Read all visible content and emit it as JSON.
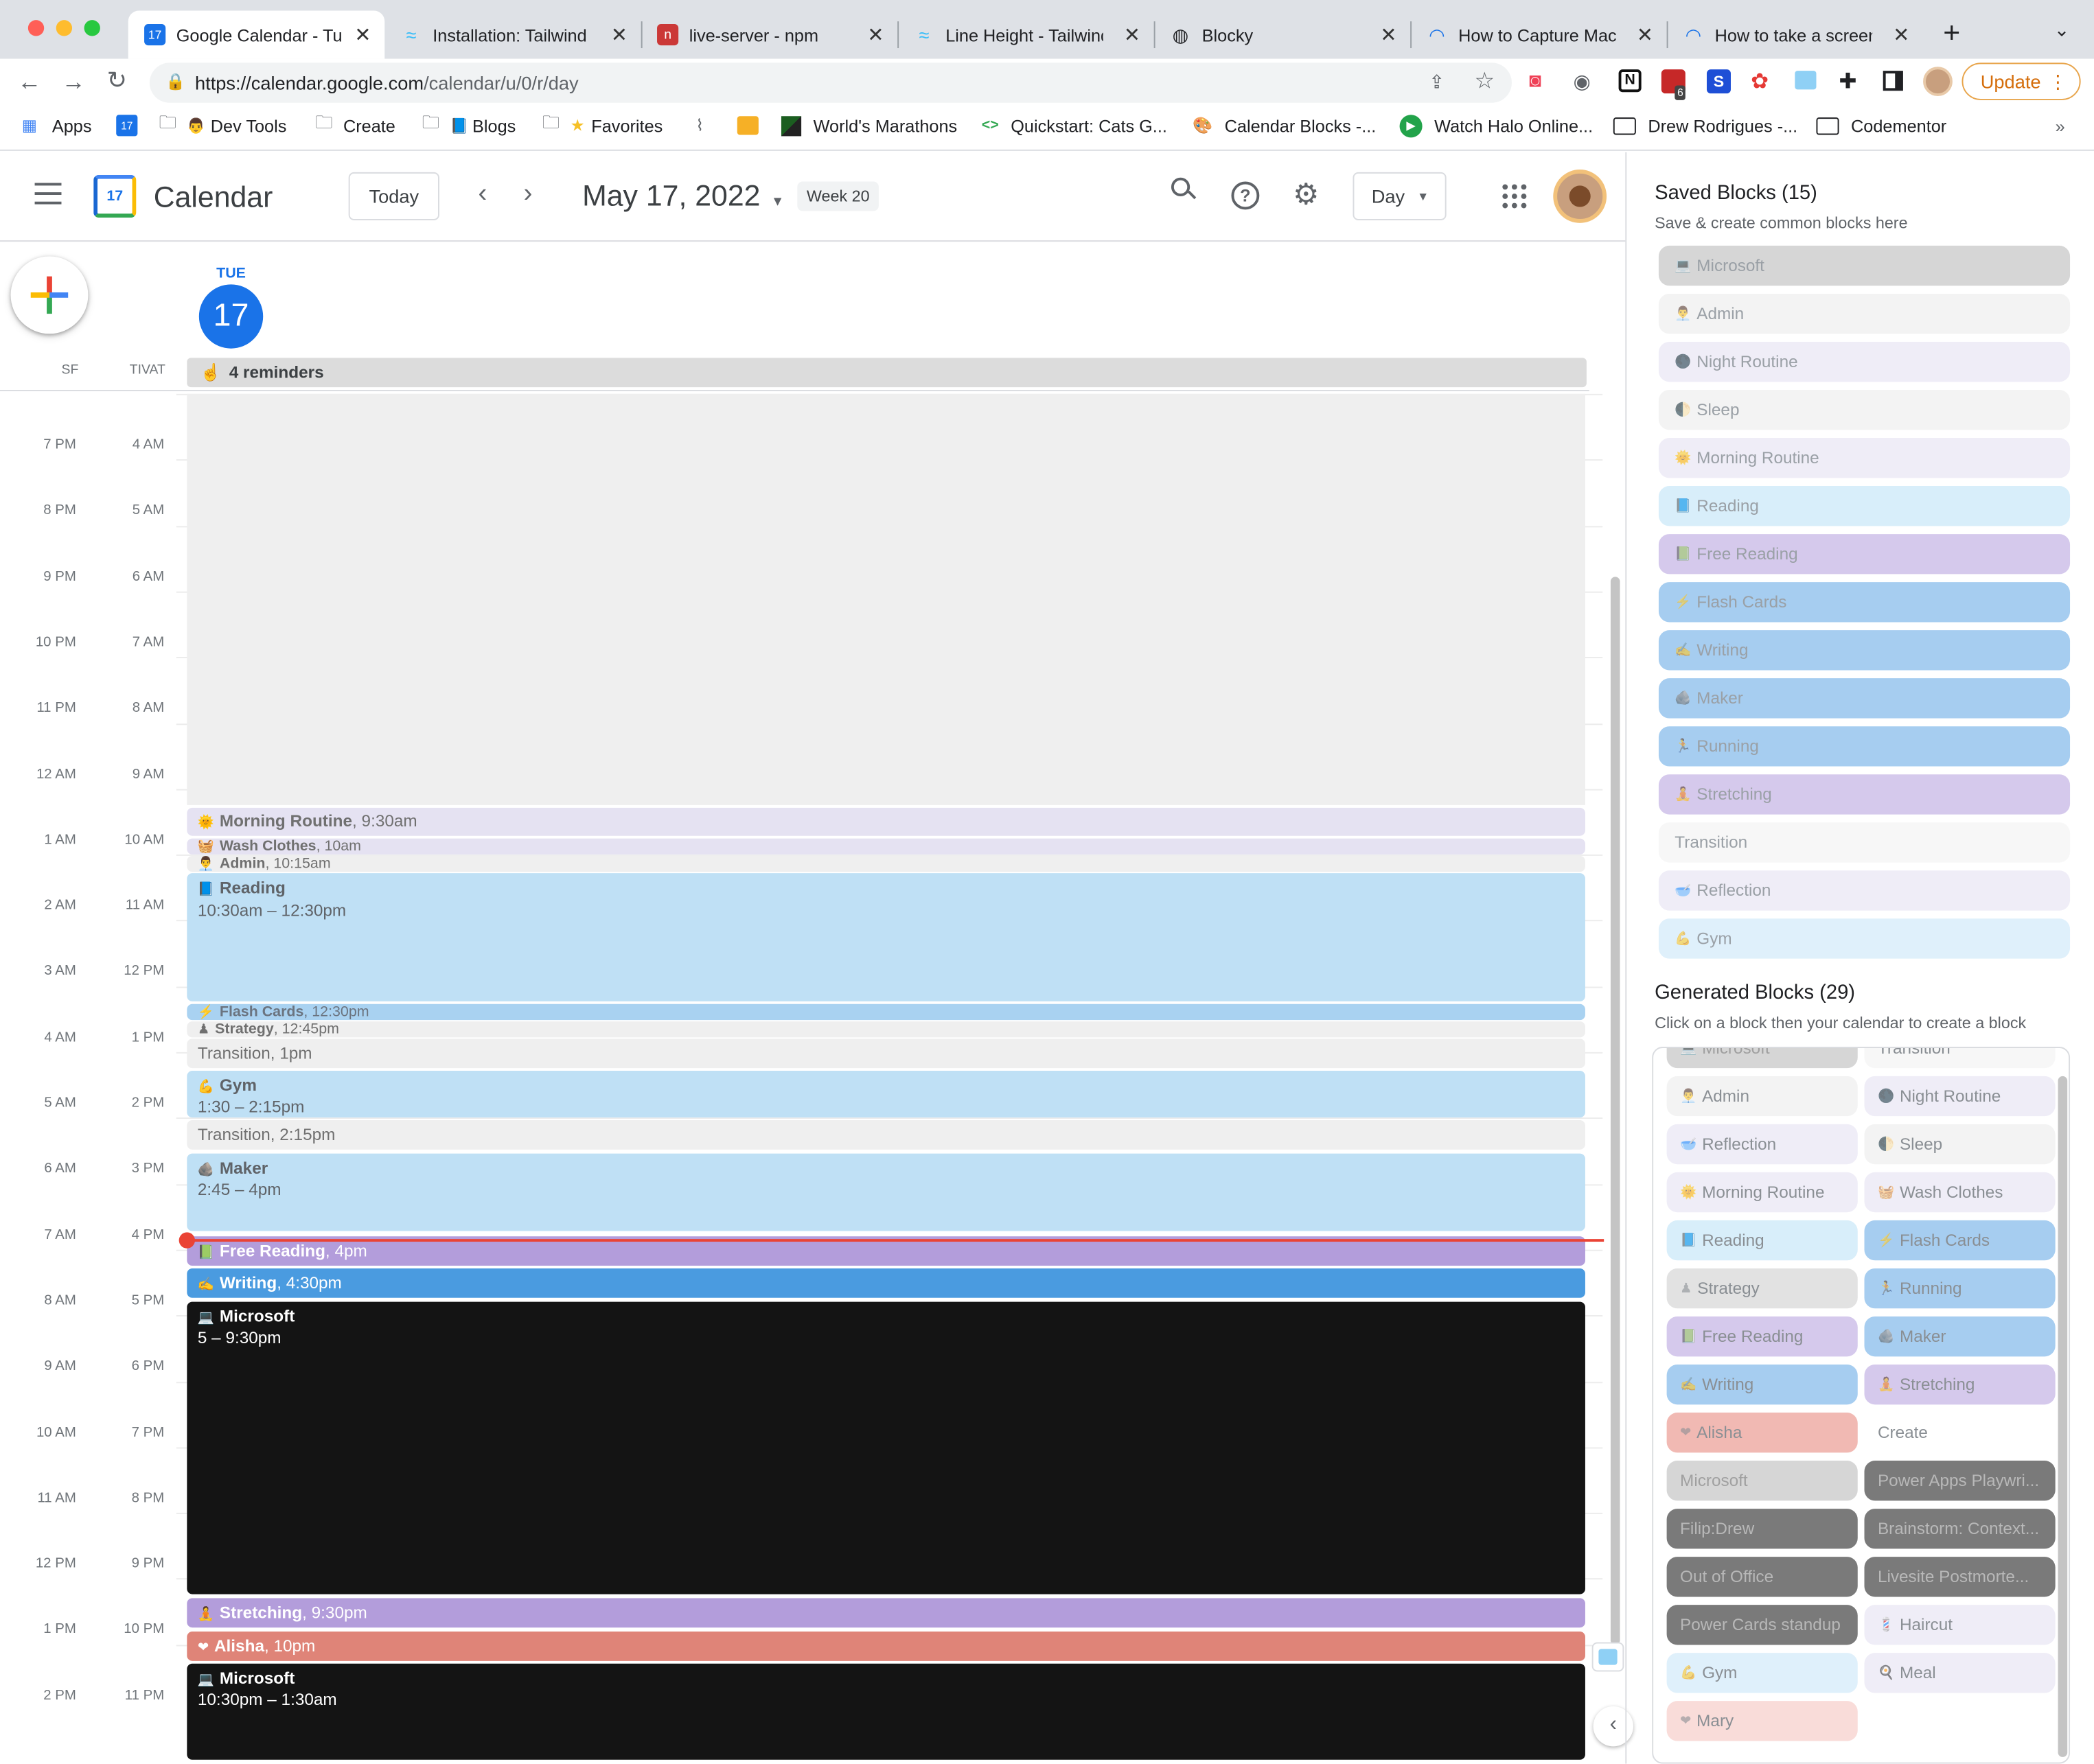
{
  "browser": {
    "tabs": [
      {
        "title": "Google Calendar - Tu",
        "icon": "calendar-icon",
        "active": true
      },
      {
        "title": "Installation: Tailwind C",
        "icon": "tailwind-icon"
      },
      {
        "title": "live-server - npm",
        "icon": "npm-icon"
      },
      {
        "title": "Line Height - Tailwind",
        "icon": "tailwind-icon"
      },
      {
        "title": "Blocky",
        "icon": "globe-icon"
      },
      {
        "title": "How to Capture Mac V",
        "icon": "loading-icon"
      },
      {
        "title": "How to take a screens",
        "icon": "loading-icon"
      }
    ],
    "url_host": "https://calendar.google.com",
    "url_path": "/calendar/u/0/r/day",
    "update_label": "Update",
    "badge_count": "6",
    "bookmarks": [
      "Apps",
      "",
      "Dev Tools",
      "Create",
      "Blogs",
      "Favorites",
      "",
      "",
      "World's Marathons",
      "Quickstart: Cats G...",
      "Calendar Blocks -...",
      "Watch Halo Online...",
      "Drew Rodrigues -...",
      "Codementor"
    ],
    "more": "»"
  },
  "header": {
    "app_name": "Calendar",
    "logo_day": "17",
    "today_label": "Today",
    "date_title": "May 17, 2022",
    "week_label": "Week 20",
    "view_label": "Day"
  },
  "day": {
    "weekday": "TUE",
    "number": "17",
    "tz1": "SF",
    "tz2": "TIVAT",
    "reminders": "4 reminders"
  },
  "times_sf": [
    "7 PM",
    "8 PM",
    "9 PM",
    "10 PM",
    "11 PM",
    "12 AM",
    "1 AM",
    "2 AM",
    "3 AM",
    "4 AM",
    "5 AM",
    "6 AM",
    "7 AM",
    "8 AM",
    "9 AM",
    "10 AM",
    "11 AM",
    "12 PM",
    "1 PM",
    "2 PM"
  ],
  "times_local": [
    "4 AM",
    "5 AM",
    "6 AM",
    "7 AM",
    "8 AM",
    "9 AM",
    "10 AM",
    "11 AM",
    "12 PM",
    "1 PM",
    "2 PM",
    "3 PM",
    "4 PM",
    "5 PM",
    "6 PM",
    "7 PM",
    "8 PM",
    "9 PM",
    "10 PM",
    "11 PM"
  ],
  "events": [
    {
      "title": "Morning Routine",
      "time": ", 9:30am",
      "emoji": "🌞"
    },
    {
      "title": "Wash Clothes",
      "time": ", 10am",
      "emoji": "🧺"
    },
    {
      "title": "Admin",
      "time": ", 10:15am",
      "emoji": "👨‍💼"
    },
    {
      "title": "Reading",
      "time": "10:30am – 12:30pm",
      "emoji": "📘"
    },
    {
      "title": "Flash Cards",
      "time": ", 12:30pm",
      "emoji": "⚡"
    },
    {
      "title": "Strategy",
      "time": ", 12:45pm",
      "emoji": "♟"
    },
    {
      "title": "Transition",
      "time": ", 1pm",
      "emoji": ""
    },
    {
      "title": "Gym",
      "time": "1:30 – 2:15pm",
      "emoji": "💪"
    },
    {
      "title": "Transition",
      "time": ", 2:15pm",
      "emoji": ""
    },
    {
      "title": "Maker",
      "time": "2:45 – 4pm",
      "emoji": "🪨"
    },
    {
      "title": "Free Reading",
      "time": ", 4pm",
      "emoji": "📗"
    },
    {
      "title": "Writing",
      "time": ", 4:30pm",
      "emoji": "✍"
    },
    {
      "title": "Microsoft",
      "time": "5 – 9:30pm",
      "emoji": "💻"
    },
    {
      "title": "Stretching",
      "time": ", 9:30pm",
      "emoji": "🧘"
    },
    {
      "title": "Alisha",
      "time": ", 10pm",
      "emoji": "❤"
    },
    {
      "title": "Microsoft",
      "time": "10:30pm – 1:30am",
      "emoji": "💻"
    }
  ],
  "sidebar": {
    "saved_title": "Saved Blocks (15)",
    "saved_sub": "Save & create common blocks here",
    "saved": [
      {
        "label": "Microsoft",
        "emoji": "💻",
        "color": "#d6d6d6"
      },
      {
        "label": "Admin",
        "emoji": "👨‍💼",
        "color": "#f3f3f3"
      },
      {
        "label": "Night Routine",
        "emoji": "🌑",
        "color": "#efedf7"
      },
      {
        "label": "Sleep",
        "emoji": "🌓",
        "color": "#f3f3f3"
      },
      {
        "label": "Morning Routine",
        "emoji": "🌞",
        "color": "#efedf7"
      },
      {
        "label": "Reading",
        "emoji": "📘",
        "color": "#d8eefa"
      },
      {
        "label": "Free Reading",
        "emoji": "📗",
        "color": "#d5c9ec"
      },
      {
        "label": "Flash Cards",
        "emoji": "⚡",
        "color": "#a6cdf0"
      },
      {
        "label": "Writing",
        "emoji": "✍",
        "color": "#a6cdf0"
      },
      {
        "label": "Maker",
        "emoji": "🪨",
        "color": "#a6cdf0"
      },
      {
        "label": "Running",
        "emoji": "🏃",
        "color": "#a6cdf0"
      },
      {
        "label": "Stretching",
        "emoji": "🧘",
        "color": "#d5c9ec"
      },
      {
        "label": "Transition",
        "emoji": "",
        "color": "#f7f7f7"
      },
      {
        "label": "Reflection",
        "emoji": "🥣",
        "color": "#efedf7"
      },
      {
        "label": "Gym",
        "emoji": "💪",
        "color": "#dff0fb"
      }
    ],
    "gen_title": "Generated Blocks (29)",
    "gen_sub": "Click on a block then your calendar to create a block",
    "generated": [
      {
        "label": "Microsoft",
        "emoji": "💻",
        "color": "#d6d6d6"
      },
      {
        "label": "Transition",
        "emoji": "",
        "color": "#f7f7f7"
      },
      {
        "label": "Admin",
        "emoji": "👨‍💼",
        "color": "#f3f3f3"
      },
      {
        "label": "Night Routine",
        "emoji": "🌑",
        "color": "#efedf7"
      },
      {
        "label": "Reflection",
        "emoji": "🥣",
        "color": "#efedf7"
      },
      {
        "label": "Sleep",
        "emoji": "🌓",
        "color": "#f3f3f3"
      },
      {
        "label": "Morning Routine",
        "emoji": "🌞",
        "color": "#efedf7"
      },
      {
        "label": "Wash Clothes",
        "emoji": "🧺",
        "color": "#efedf7"
      },
      {
        "label": "Reading",
        "emoji": "📘",
        "color": "#d8eefa"
      },
      {
        "label": "Flash Cards",
        "emoji": "⚡",
        "color": "#a6cdf0"
      },
      {
        "label": "Strategy",
        "emoji": "♟",
        "color": "#e2e2e2"
      },
      {
        "label": "Running",
        "emoji": "🏃",
        "color": "#a6cdf0"
      },
      {
        "label": "Free Reading",
        "emoji": "📗",
        "color": "#d5c9ec"
      },
      {
        "label": "Maker",
        "emoji": "🪨",
        "color": "#a6cdf0"
      },
      {
        "label": "Writing",
        "emoji": "✍",
        "color": "#a6cdf0"
      },
      {
        "label": "Stretching",
        "emoji": "🧘",
        "color": "#d5c9ec"
      },
      {
        "label": "Alisha",
        "emoji": "❤",
        "color": "#f1b9b3"
      },
      {
        "label": "Create",
        "emoji": "",
        "color": "#ffffff"
      },
      {
        "label": "Microsoft",
        "emoji": "",
        "color": "#d6d6d6"
      },
      {
        "label": "Power Apps Playwri...",
        "emoji": "",
        "color": "#7a7a7a"
      },
      {
        "label": "Filip:Drew",
        "emoji": "",
        "color": "#7a7a7a"
      },
      {
        "label": "Brainstorm: Context...",
        "emoji": "",
        "color": "#7a7a7a"
      },
      {
        "label": "Out of Office",
        "emoji": "",
        "color": "#7a7a7a"
      },
      {
        "label": "Livesite Postmorte...",
        "emoji": "",
        "color": "#7a7a7a"
      },
      {
        "label": "Power Cards standup",
        "emoji": "",
        "color": "#7a7a7a"
      },
      {
        "label": "Haircut",
        "emoji": "💈",
        "color": "#efedf7"
      },
      {
        "label": "Gym",
        "emoji": "💪",
        "color": "#dff0fb"
      },
      {
        "label": "Meal",
        "emoji": "🍳",
        "color": "#efedf7"
      },
      {
        "label": "Mary",
        "emoji": "❤",
        "color": "#f9dcd9"
      }
    ]
  }
}
